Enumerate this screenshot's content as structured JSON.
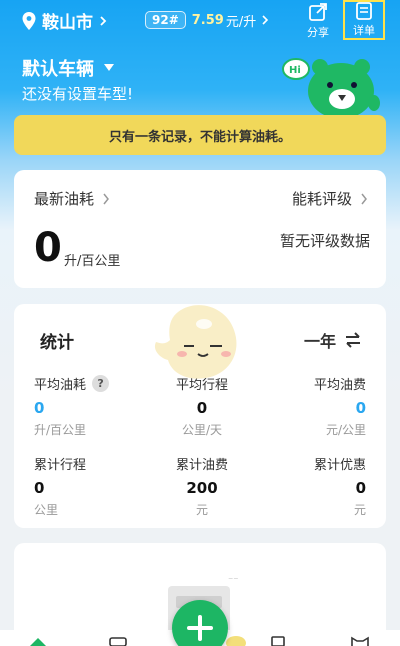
{
  "header": {
    "city": "鞍山市",
    "octane": "92#",
    "price_value": "7.59",
    "price_unit": "元/升",
    "share_label": "分享",
    "detail_label": "详单"
  },
  "vehicle": {
    "name": "默认车辆",
    "hint": "还没有设置车型!"
  },
  "mascot": {
    "bubble": "Hi"
  },
  "notice": "只有一条记录，不能计算油耗。",
  "consumption_card": {
    "latest_label": "最新油耗",
    "rating_label": "能耗评级",
    "value": "0",
    "unit": "升/百公里",
    "no_rating": "暂无评级数据"
  },
  "stats": {
    "title": "统计",
    "period": "一年",
    "qmark": "?",
    "cells": [
      {
        "label": "平均油耗",
        "value": "0",
        "unit": "升/百公里"
      },
      {
        "label": "平均行程",
        "value": "0",
        "unit": "公里/天"
      },
      {
        "label": "平均油费",
        "value": "0",
        "unit": "元/公里"
      },
      {
        "label": "累计行程",
        "value": "0",
        "unit": "公里"
      },
      {
        "label": "累计油费",
        "value": "200",
        "unit": "元"
      },
      {
        "label": "累计优惠",
        "value": "0",
        "unit": "元"
      }
    ]
  },
  "colors": {
    "accent_blue": "#2aa7f0",
    "notice_yellow": "#f1d85a",
    "fab_green": "#1db664",
    "price_yellow": "#fff3a0"
  },
  "icons": {
    "location": "location-pin-icon",
    "share": "share-icon",
    "detail": "document-list-icon",
    "switch": "swap-arrows-icon",
    "add": "plus-icon"
  }
}
